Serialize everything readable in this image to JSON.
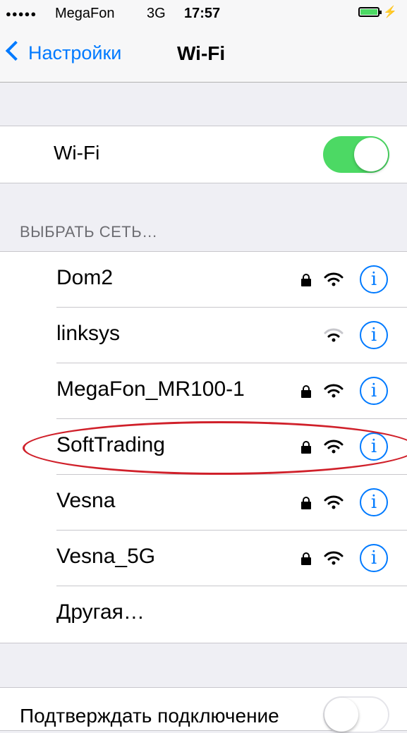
{
  "status": {
    "signal": "●●●●●",
    "carrier": "MegaFon",
    "network": "3G",
    "time": "17:57",
    "battery_charging_icon": "bolt-icon"
  },
  "nav": {
    "back_label": "Настройки",
    "title": "Wi-Fi"
  },
  "wifi": {
    "label": "Wi-Fi",
    "enabled": true
  },
  "section_header": "ВЫБРАТЬ СЕТЬ…",
  "networks": [
    {
      "name": "Dom2",
      "secured": true
    },
    {
      "name": "linksys",
      "secured": false
    },
    {
      "name": "MegaFon_MR100-1",
      "secured": true
    },
    {
      "name": "SoftTrading",
      "secured": true
    },
    {
      "name": "Vesna",
      "secured": true
    },
    {
      "name": "Vesna_5G",
      "secured": true
    }
  ],
  "other": "Другая…",
  "info_glyph": "i",
  "confirm": {
    "label": "Подтверждать подключение",
    "enabled": false
  },
  "colors": {
    "accent": "#007aff",
    "toggle_on": "#4cd964",
    "highlight": "#d0202a"
  }
}
